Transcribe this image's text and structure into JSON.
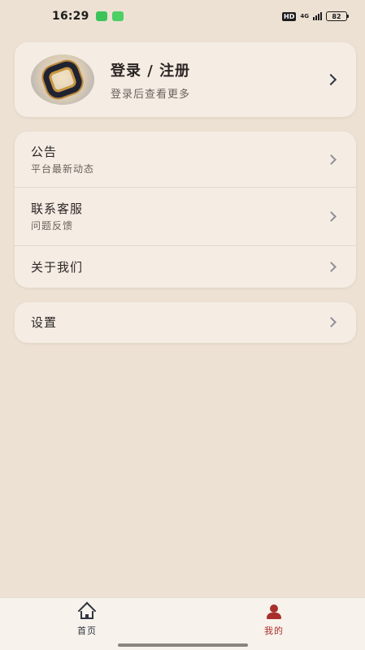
{
  "status_bar": {
    "time": "16:29",
    "hd": "HD",
    "network": "4G",
    "battery": "82"
  },
  "profile": {
    "title": "登录 / 注册",
    "subtitle": "登录后查看更多"
  },
  "menu": [
    {
      "title": "公告",
      "subtitle": "平台最新动态"
    },
    {
      "title": "联系客服",
      "subtitle": "问题反馈"
    },
    {
      "title": "关于我们"
    }
  ],
  "settings": {
    "title": "设置"
  },
  "bottom_nav": {
    "home_label": "首页",
    "mine_label": "我的",
    "active": "mine",
    "active_color": "#a8302c",
    "inactive_color": "#2f3440"
  }
}
